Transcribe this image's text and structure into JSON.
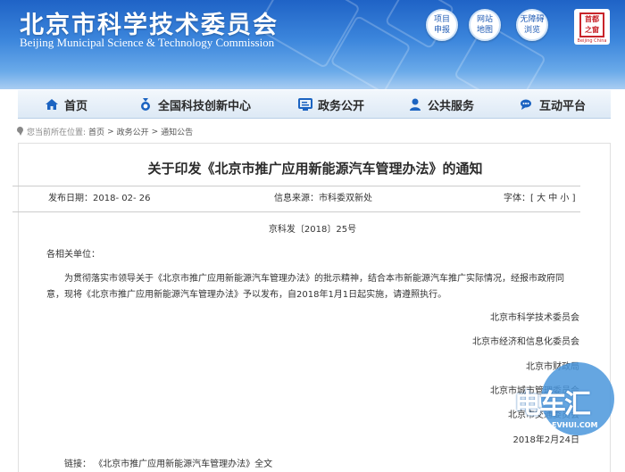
{
  "header": {
    "title_cn": "北京市科学技术委员会",
    "title_en": "Beijing Municipal Science & Technology Commission",
    "quick_links": [
      {
        "label": "项目申报"
      },
      {
        "label": "网站地图"
      },
      {
        "label": "无障碍浏览"
      }
    ],
    "logo": {
      "seal_text": "首都之窗",
      "caption": "Beijing China"
    }
  },
  "nav": {
    "items": [
      {
        "label": "首页",
        "icon": "home-icon"
      },
      {
        "label": "全国科技创新中心",
        "icon": "medal-icon"
      },
      {
        "label": "政务公开",
        "icon": "monitor-icon"
      },
      {
        "label": "公共服务",
        "icon": "person-icon"
      },
      {
        "label": "互动平台",
        "icon": "chat-icon"
      }
    ],
    "accent": "#1b63c1"
  },
  "breadcrumb": {
    "prefix": "您当前所在位置:",
    "items": [
      "首页",
      "政务公开",
      "通知公告"
    ],
    "separator": ">"
  },
  "article": {
    "title": "关于印发《北京市推广应用新能源汽车管理办法》的通知",
    "publish_date_label": "发布日期：",
    "publish_date": "2018- 02- 26",
    "source_label": "信息来源：",
    "source": "市科委双新处",
    "fontsize_label": "字体：",
    "fontsize_options": "[ 大 中 小 ]",
    "doc_number": "京科发〔2018〕25号",
    "salutation": "各相关单位：",
    "para1_line1": "为贯彻落实市领导关于《北京市推广应用新能源汽车管理办法》的批示精神，结合本市新能源汽车推广实际情况，经报市政府同",
    "para1_line2": "意，现将《北京市推广应用新能源汽车管理办法》予以发布，自2018年1月1日起实施，请遵照执行。",
    "signatories": [
      "北京市科学技术委员会",
      "北京市经济和信息化委员会",
      "北京市财政局",
      "北京市城市管理委员会",
      "北京市交通委员会"
    ],
    "sign_date": "2018年2月24日",
    "link_label": "链接：",
    "link_text": "《北京市推广应用新能源汽车管理办法》全文"
  },
  "watermark": {
    "text": "电车汇",
    "sub": "EVHUI.COM"
  }
}
